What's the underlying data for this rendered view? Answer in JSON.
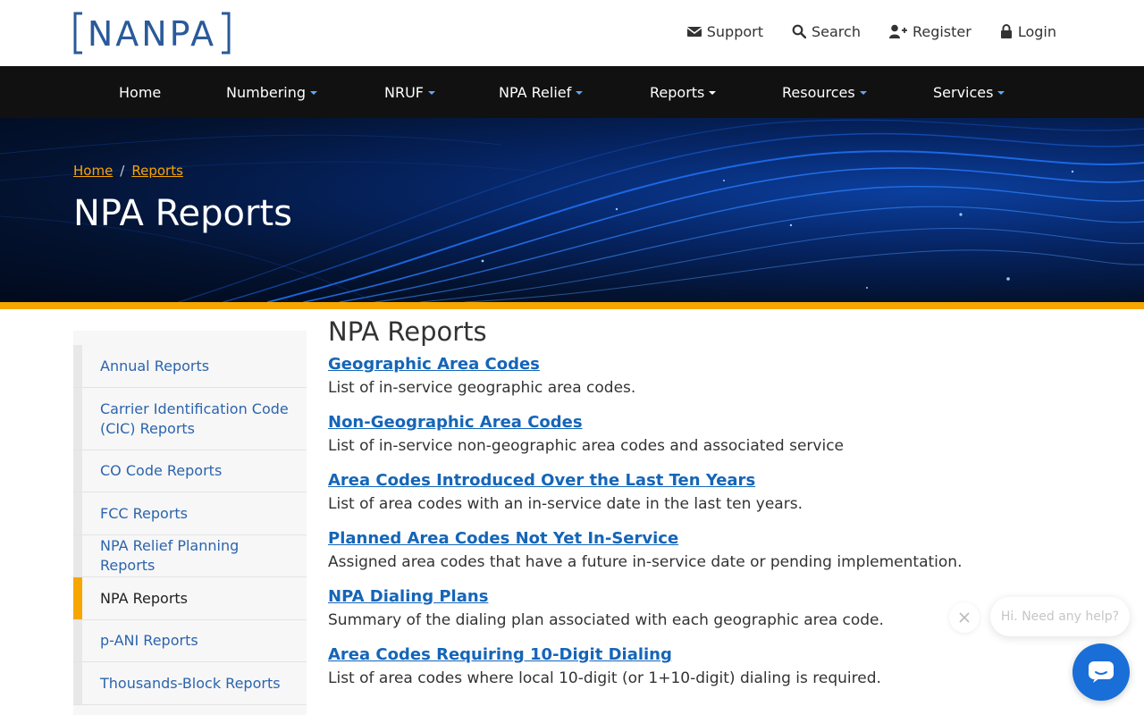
{
  "brand": {
    "logo_text": "NANPA"
  },
  "utility_nav": [
    {
      "label": "Support",
      "icon": "envelope-icon"
    },
    {
      "label": "Search",
      "icon": "search-icon"
    },
    {
      "label": "Register",
      "icon": "user-plus-icon"
    },
    {
      "label": "Login",
      "icon": "lock-icon"
    }
  ],
  "main_nav": [
    {
      "label": "Home",
      "dropdown": false
    },
    {
      "label": "Numbering",
      "dropdown": true
    },
    {
      "label": "NRUF",
      "dropdown": true
    },
    {
      "label": "NPA Relief",
      "dropdown": true
    },
    {
      "label": "Reports",
      "dropdown": true
    },
    {
      "label": "Resources",
      "dropdown": true
    },
    {
      "label": "Services",
      "dropdown": true
    }
  ],
  "breadcrumb": {
    "items": [
      "Home",
      "Reports"
    ],
    "separator": "/"
  },
  "hero": {
    "title": "NPA Reports"
  },
  "sidebar": {
    "items": [
      {
        "label": "Annual Reports",
        "active": false
      },
      {
        "label": "Carrier Identification Code (CIC) Reports",
        "active": false
      },
      {
        "label": "CO Code Reports",
        "active": false
      },
      {
        "label": "FCC Reports",
        "active": false
      },
      {
        "label": "NPA Relief Planning Reports",
        "active": false
      },
      {
        "label": "NPA Reports",
        "active": true
      },
      {
        "label": "p-ANI Reports",
        "active": false
      },
      {
        "label": "Thousands-Block Reports",
        "active": false
      }
    ]
  },
  "content": {
    "heading": "NPA Reports",
    "reports": [
      {
        "title": "Geographic Area Codes",
        "desc": "List of in-service geographic area codes."
      },
      {
        "title": "Non-Geographic Area Codes",
        "desc": "List of in-service non-geographic area codes and associated service"
      },
      {
        "title": "Area Codes Introduced Over the Last Ten Years",
        "desc": "List of area codes with an in-service date in the last ten years."
      },
      {
        "title": "Planned Area Codes Not Yet In-Service",
        "desc": "Assigned area codes that have a future in-service date or pending implementation."
      },
      {
        "title": "NPA Dialing Plans",
        "desc": "Summary of the dialing plan associated with each geographic area code."
      },
      {
        "title": "Area Codes Requiring 10-Digit Dialing",
        "desc": "List of area codes where local 10-digit (or 1+10-digit) dialing is required."
      }
    ]
  },
  "chat": {
    "prompt": "Hi. Need any help?",
    "close_icon": "close-icon",
    "launcher_icon": "chat-icon"
  },
  "colors": {
    "accent": "#f7a600",
    "link": "#1565b8",
    "nav_bg": "#111111",
    "chat": "#1a6ed8"
  }
}
